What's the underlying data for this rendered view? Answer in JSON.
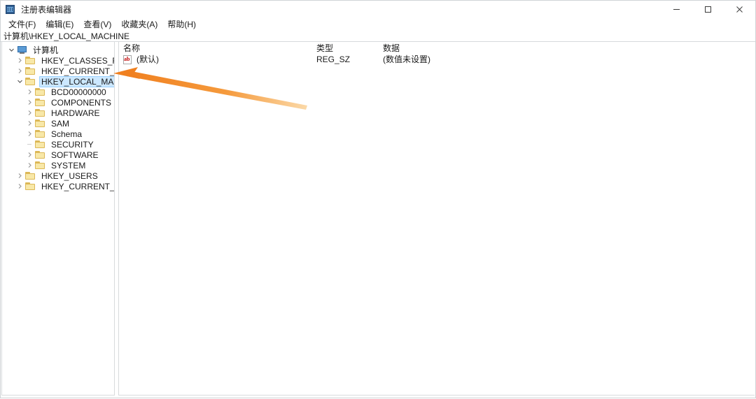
{
  "window": {
    "title": "注册表编辑器",
    "icon": "registry-editor-icon",
    "controls": {
      "minimize": "minimize-icon",
      "maximize": "maximize-icon",
      "close": "close-icon"
    }
  },
  "menubar": {
    "items": [
      {
        "label": "文件(F)"
      },
      {
        "label": "编辑(E)"
      },
      {
        "label": "查看(V)"
      },
      {
        "label": "收藏夹(A)"
      },
      {
        "label": "帮助(H)"
      }
    ]
  },
  "address": {
    "path": "计算机\\HKEY_LOCAL_MACHINE"
  },
  "tree": {
    "items": [
      {
        "label": "计算机",
        "depth": 0,
        "icon": "computer-icon",
        "expander": "expanded",
        "selected": false
      },
      {
        "label": "HKEY_CLASSES_ROOT",
        "depth": 1,
        "icon": "folder-icon",
        "expander": "collapsed",
        "selected": false
      },
      {
        "label": "HKEY_CURRENT_USER",
        "depth": 1,
        "icon": "folder-icon",
        "expander": "collapsed",
        "selected": false
      },
      {
        "label": "HKEY_LOCAL_MACHINE",
        "depth": 1,
        "icon": "folder-icon",
        "expander": "expanded",
        "selected": true
      },
      {
        "label": "BCD00000000",
        "depth": 2,
        "icon": "folder-icon",
        "expander": "collapsed",
        "selected": false
      },
      {
        "label": "COMPONENTS",
        "depth": 2,
        "icon": "folder-icon",
        "expander": "collapsed",
        "selected": false
      },
      {
        "label": "HARDWARE",
        "depth": 2,
        "icon": "folder-icon",
        "expander": "collapsed",
        "selected": false
      },
      {
        "label": "SAM",
        "depth": 2,
        "icon": "folder-icon",
        "expander": "collapsed",
        "selected": false
      },
      {
        "label": "Schema",
        "depth": 2,
        "icon": "folder-icon",
        "expander": "collapsed",
        "selected": false
      },
      {
        "label": "SECURITY",
        "depth": 2,
        "icon": "folder-icon",
        "expander": "none",
        "selected": false
      },
      {
        "label": "SOFTWARE",
        "depth": 2,
        "icon": "folder-icon",
        "expander": "collapsed",
        "selected": false
      },
      {
        "label": "SYSTEM",
        "depth": 2,
        "icon": "folder-icon",
        "expander": "collapsed",
        "selected": false
      },
      {
        "label": "HKEY_USERS",
        "depth": 1,
        "icon": "folder-icon",
        "expander": "collapsed",
        "selected": false
      },
      {
        "label": "HKEY_CURRENT_CONFIG",
        "depth": 1,
        "icon": "folder-icon",
        "expander": "collapsed",
        "selected": false
      }
    ]
  },
  "values": {
    "columns": {
      "name": "名称",
      "type": "类型",
      "data": "数据"
    },
    "rows": [
      {
        "icon": "string-value-icon",
        "name": "(默认)",
        "type": "REG_SZ",
        "data": "(数值未设置)"
      }
    ]
  },
  "annotation": {
    "arrow": "orange-arrow-pointing-left",
    "color": "#F08020"
  }
}
